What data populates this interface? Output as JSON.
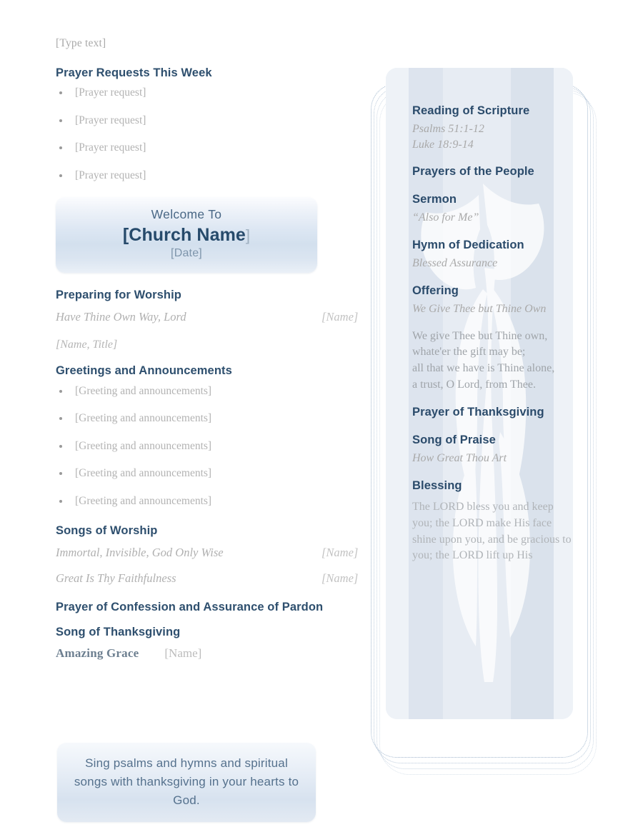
{
  "document": {
    "type": "church-bulletin",
    "accent_color": "#2e4f6e",
    "muted_color": "#b0b0b0",
    "box_gradient_top": "#fbfcfe",
    "box_gradient_mid": "#d3e0ee"
  },
  "left": {
    "type_text": "[Type text]",
    "prayer_section": {
      "heading": "Prayer Requests This Week",
      "items": [
        "[Prayer request]",
        "[Prayer request]",
        "[Prayer request]",
        "[Prayer request]"
      ]
    },
    "welcome": {
      "line1": "Welcome To",
      "church_name": "[Church Name",
      "bracket_close": "]",
      "date": "[Date]"
    },
    "preparing": {
      "heading": "Preparing for Worship",
      "song_title": "Have Thine Own Way, Lord",
      "song_name": "[Name]",
      "presenter": "[Name, Title]"
    },
    "greetings": {
      "heading": "Greetings and Announcements",
      "items": [
        "[Greeting and announcements]",
        "[Greeting and announcements]",
        "[Greeting and announcements]",
        "[Greeting and announcements]",
        "[Greeting and announcements]"
      ]
    },
    "songs_of_worship": {
      "heading": "Songs of Worship",
      "songs": [
        {
          "title": "Immortal, Invisible, God Only Wise",
          "name": "[Name]"
        },
        {
          "title": "Great Is Thy Faithfulness",
          "name": "[Name]"
        }
      ]
    },
    "confession": {
      "heading": "Prayer of Confession and Assurance of Pardon"
    },
    "thanksgiving": {
      "heading": "Song of Thanksgiving",
      "song_title": "Amazing Grace",
      "song_name": "[Name]"
    },
    "quote": "Sing psalms and hymns and spiritual songs with thanksgiving in your hearts to God."
  },
  "right": {
    "scripture": {
      "heading": "Reading of Scripture",
      "readings": [
        "Psalms 51:1-12",
        "Luke 18:9-14"
      ]
    },
    "prayers_of_people": {
      "heading": "Prayers of the People"
    },
    "sermon": {
      "heading": "Sermon",
      "title": "“Also for Me”"
    },
    "hymn_of_dedication": {
      "heading": "Hymn of Dedication",
      "title": "Blessed Assurance"
    },
    "offering": {
      "heading": "Offering",
      "title": "We Give Thee but Thine Own",
      "verse_lines": [
        "We give Thee but Thine own,",
        "whate'er the gift may be;",
        "all that we have is Thine alone,",
        "a trust, O Lord, from Thee."
      ]
    },
    "prayer_of_thanksgiving": {
      "heading": "Prayer of Thanksgiving"
    },
    "song_of_praise": {
      "heading": "Song of Praise",
      "title": "How Great Thou Art"
    },
    "blessing": {
      "heading": "Blessing",
      "text": "The LORD bless you and keep you; the LORD make His face shine upon you, and be gracious to you; the LORD lift up His"
    }
  }
}
